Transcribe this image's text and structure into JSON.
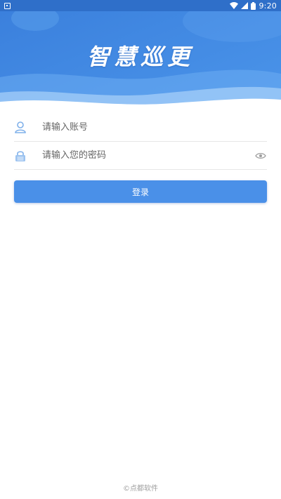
{
  "status_bar": {
    "time": "9:20",
    "icons": [
      "notification-icon",
      "wifi-icon",
      "cell-signal-icon",
      "battery-icon"
    ]
  },
  "header": {
    "title": "智慧巡更"
  },
  "form": {
    "account_placeholder": "请输入账号",
    "password_placeholder": "请输入您的密码",
    "account_icon": "user-icon",
    "password_icon": "lock-icon",
    "toggle_icon": "eye-icon"
  },
  "login_button_label": "登录",
  "footer": "©点都软件",
  "colors": {
    "header_blue": "#3b84e0",
    "header_light": "#5aa3f0",
    "button_blue": "#4a90e8",
    "icon_blue": "#7fb0ea"
  }
}
